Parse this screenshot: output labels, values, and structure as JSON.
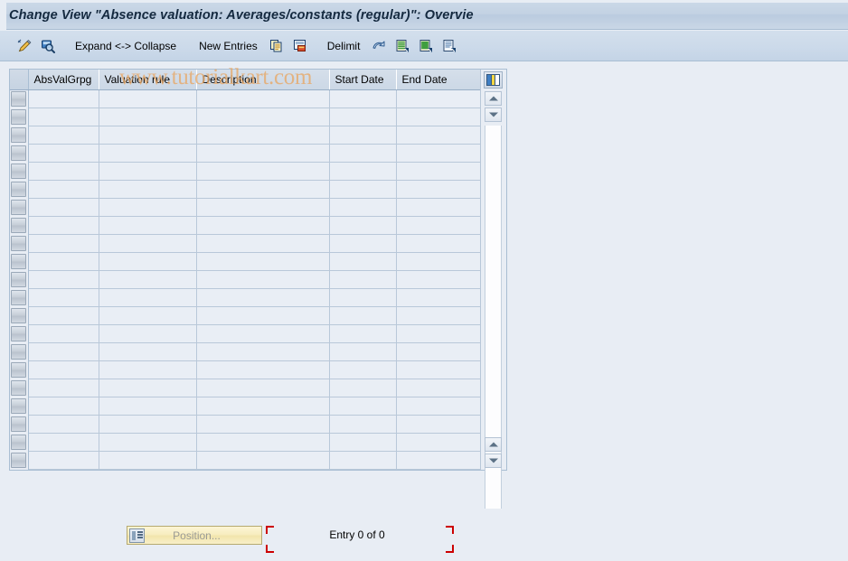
{
  "window": {
    "title": "Change View \"Absence valuation: Averages/constants (regular)\": Overvie"
  },
  "watermark": {
    "text": "www.tutorialkart.com",
    "color": "#e8a866"
  },
  "toolbar": {
    "items": [
      {
        "icon": "pencil-display-change-icon",
        "label": ""
      },
      {
        "icon": "magnifier-details-icon",
        "label": ""
      },
      {
        "icon": "",
        "label": "Expand <-> Collapse"
      },
      {
        "icon": "",
        "label": "New Entries"
      },
      {
        "icon": "copy-icon",
        "label": ""
      },
      {
        "icon": "paste-icon",
        "label": ""
      },
      {
        "icon": "",
        "label": "Delimit"
      },
      {
        "icon": "undo-arrow-icon",
        "label": ""
      },
      {
        "icon": "select-all-icon",
        "label": ""
      },
      {
        "icon": "deselect-all-icon",
        "label": ""
      },
      {
        "icon": "variant-list-icon",
        "label": ""
      }
    ],
    "expand_collapse_label": "Expand <-> Collapse",
    "new_entries_label": "New Entries",
    "delimit_label": "Delimit"
  },
  "table": {
    "columns": [
      {
        "key": "selector",
        "label": ""
      },
      {
        "key": "absvalgrpg",
        "label": "AbsValGrpg"
      },
      {
        "key": "valuation_rule",
        "label": "Valuation rule"
      },
      {
        "key": "description",
        "label": "Description"
      },
      {
        "key": "start_date",
        "label": "Start Date"
      },
      {
        "key": "end_date",
        "label": "End Date"
      }
    ],
    "rows": [
      [
        "",
        "",
        "",
        "",
        ""
      ],
      [
        "",
        "",
        "",
        "",
        ""
      ],
      [
        "",
        "",
        "",
        "",
        ""
      ],
      [
        "",
        "",
        "",
        "",
        ""
      ],
      [
        "",
        "",
        "",
        "",
        ""
      ],
      [
        "",
        "",
        "",
        "",
        ""
      ],
      [
        "",
        "",
        "",
        "",
        ""
      ],
      [
        "",
        "",
        "",
        "",
        ""
      ],
      [
        "",
        "",
        "",
        "",
        ""
      ],
      [
        "",
        "",
        "",
        "",
        ""
      ],
      [
        "",
        "",
        "",
        "",
        ""
      ],
      [
        "",
        "",
        "",
        "",
        ""
      ],
      [
        "",
        "",
        "",
        "",
        ""
      ],
      [
        "",
        "",
        "",
        "",
        ""
      ],
      [
        "",
        "",
        "",
        "",
        ""
      ],
      [
        "",
        "",
        "",
        "",
        ""
      ],
      [
        "",
        "",
        "",
        "",
        ""
      ],
      [
        "",
        "",
        "",
        "",
        ""
      ],
      [
        "",
        "",
        "",
        "",
        ""
      ],
      [
        "",
        "",
        "",
        "",
        ""
      ],
      [
        "",
        "",
        "",
        "",
        ""
      ]
    ],
    "row_count": 21
  },
  "scrollbar": {
    "column_select_icon": "column-configuration-icon",
    "scroll_up_icon": "triangle-up-icon",
    "scroll_down_icon": "triangle-down-icon"
  },
  "footer": {
    "position_button_label": "Position...",
    "position_button_icon": "position-list-icon",
    "entry_count_text": "Entry 0 of 0",
    "marker_color": "#cc0000"
  },
  "colors": {
    "window_background": "#e8edf4",
    "titlebar": "#c6d4e4",
    "toolbar": "#ccdaea",
    "grid_cell": "#e9eef5",
    "grid_line": "#b9c8d9",
    "header_text": "#14293f"
  }
}
